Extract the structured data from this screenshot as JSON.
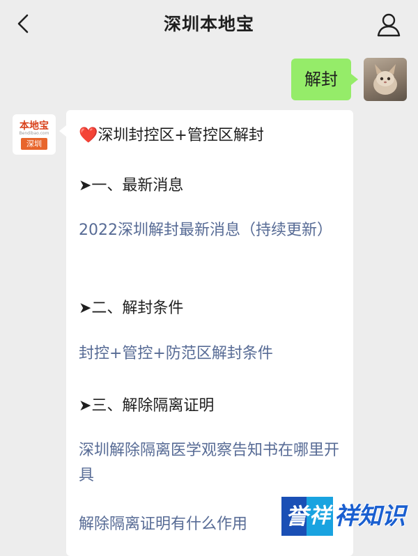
{
  "header": {
    "title": "深圳本地宝",
    "back_icon": "chevron-left-icon",
    "profile_icon": "person-icon"
  },
  "my_message": {
    "text": "解封"
  },
  "bot": {
    "logo_name": "本地宝",
    "logo_domain": "Bendibao.com",
    "logo_city": "深圳"
  },
  "reply": {
    "heading_prefix": "❤️",
    "heading": "深圳封控区+管控区解封",
    "sections": [
      {
        "title": "➤一、最新消息",
        "links": [
          "2022深圳解封最新消息（持续更新）"
        ]
      },
      {
        "title": "➤二、解封条件",
        "links": [
          "封控+管控+防范区解封条件"
        ]
      },
      {
        "title": "➤三、解除隔离证明",
        "links": [
          "深圳解除隔离医学观察告知书在哪里开具",
          "解除隔离证明有什么作用"
        ]
      }
    ]
  },
  "watermark": {
    "char1": "誉",
    "char2": "祥",
    "rest": "祥知识"
  },
  "colors": {
    "background": "#ededed",
    "my_bubble": "#95ec69",
    "link": "#576b95",
    "brand": "#e8652b"
  }
}
